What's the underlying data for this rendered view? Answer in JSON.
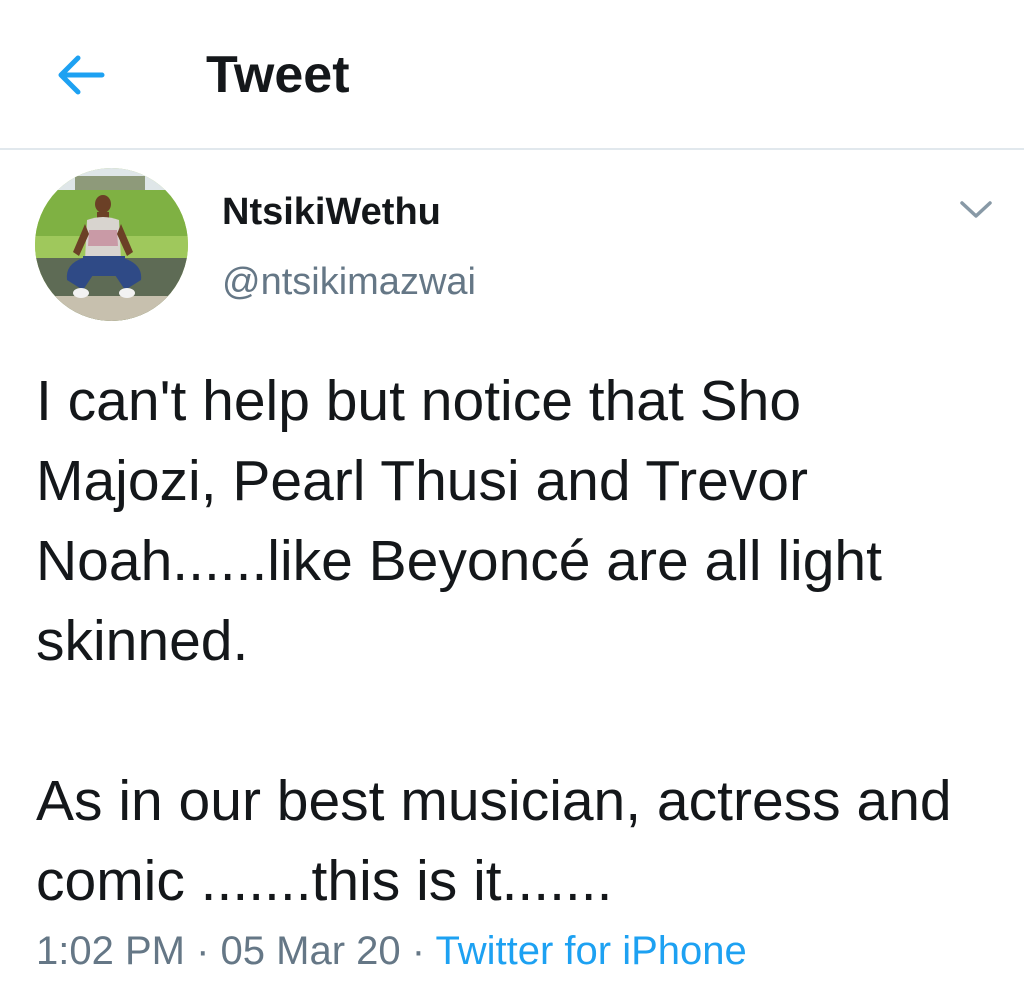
{
  "header": {
    "title": "Tweet",
    "back_icon": "arrow-left-icon"
  },
  "tweet": {
    "author": {
      "display_name": "NtsikiWethu",
      "handle": "@ntsikimazwai"
    },
    "menu_icon": "chevron-down-icon",
    "paragraphs": [
      "I can't help but notice that Sho Majozi, Pearl Thusi and Trevor Noah......like Beyoncé are all light skinned.",
      "As in our best musician, actress and comic .......this is it......."
    ],
    "time": "1:02 PM",
    "separator": "·",
    "date": "05 Mar 20",
    "source": "Twitter for iPhone"
  },
  "colors": {
    "accent": "#1da1f2",
    "text_primary": "#14171a",
    "text_secondary": "#657786",
    "divider": "#e1e8ed"
  }
}
